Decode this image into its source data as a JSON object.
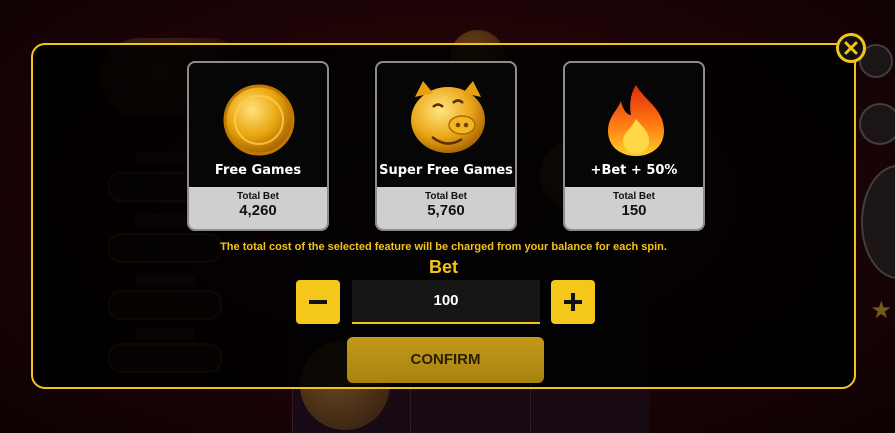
{
  "modal": {
    "cards": [
      {
        "title": "Free Games",
        "total_bet_label": "Total Bet",
        "total_bet_value": "4,260",
        "icon": "gold-coin-icon"
      },
      {
        "title": "Super Free Games",
        "total_bet_label": "Total Bet",
        "total_bet_value": "5,760",
        "icon": "golden-pig-icon"
      },
      {
        "title": "+Bet + 50%",
        "total_bet_label": "Total Bet",
        "total_bet_value": "150",
        "icon": "flame-icon"
      }
    ],
    "notice": "The total cost of the selected feature will be charged from your balance for each spin.",
    "bet_label": "Bet",
    "bet_value": "100",
    "confirm_label": "CONFIRM"
  },
  "colors": {
    "accent": "#f2c418",
    "card_footer": "#cfcfcf",
    "confirm": "#b8900f"
  }
}
